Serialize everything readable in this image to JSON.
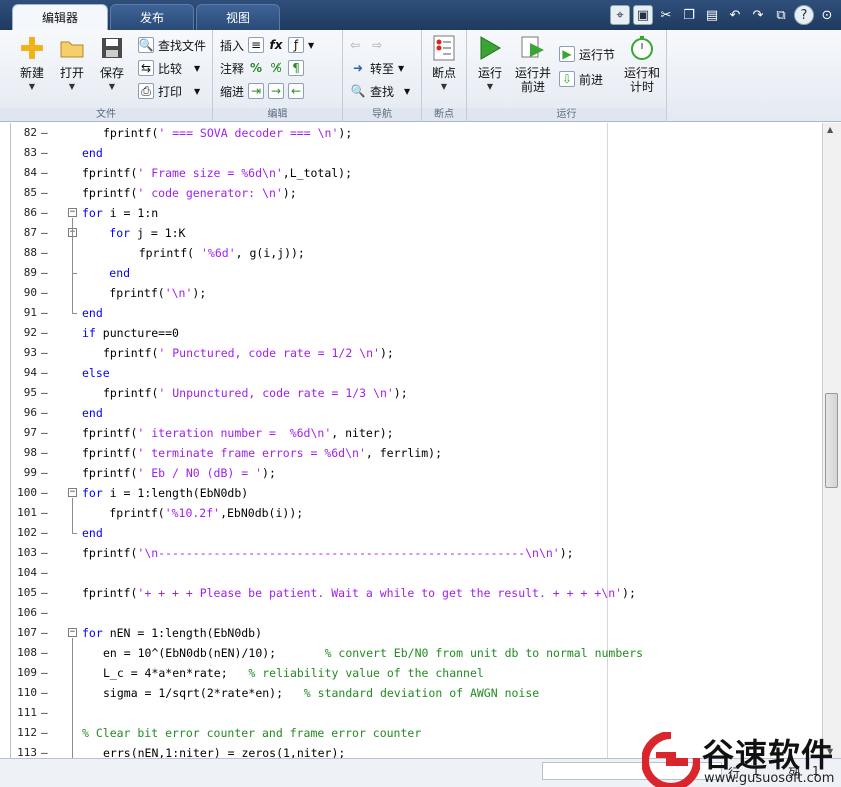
{
  "tabs": [
    {
      "label": "编辑器",
      "active": true
    },
    {
      "label": "发布",
      "active": false
    },
    {
      "label": "视图",
      "active": false
    }
  ],
  "ribbon": {
    "file": {
      "group_label": "文件",
      "new_label": "新建",
      "open_label": "打开",
      "save_label": "保存",
      "find_files_label": "查找文件",
      "compare_label": "比较",
      "print_label": "打印"
    },
    "edit": {
      "group_label": "编辑",
      "insert_label": "插入",
      "comment_label": "注释",
      "indent_label": "缩进"
    },
    "navigate": {
      "group_label": "导航",
      "goto_label": "转至",
      "find_label": "查找"
    },
    "breakpoints": {
      "group_label": "断点",
      "breakpoint_label": "断点"
    },
    "run": {
      "group_label": "运行",
      "run_label": "运行",
      "run_advance_label_1": "运行并",
      "run_advance_label_2": "前进",
      "run_section_label": "运行节",
      "advance_label": "前进",
      "run_time_label_1": "运行和",
      "run_time_label_2": "计时"
    }
  },
  "code_lines": [
    {
      "n": "82",
      "indent": 1,
      "tokens": [
        [
          "t",
          "fprintf("
        ],
        [
          "s",
          "' === SOVA decoder === \\n'"
        ],
        [
          "t",
          ");"
        ]
      ]
    },
    {
      "n": "83",
      "indent": 0,
      "tokens": [
        [
          "k",
          "end"
        ]
      ]
    },
    {
      "n": "84",
      "indent": 0,
      "tokens": [
        [
          "t",
          "fprintf("
        ],
        [
          "s",
          "' Frame size = %6d\\n'"
        ],
        [
          "t",
          ",L_total);"
        ]
      ]
    },
    {
      "n": "85",
      "indent": 0,
      "tokens": [
        [
          "t",
          "fprintf("
        ],
        [
          "s",
          "' code generator: \\n'"
        ],
        [
          "t",
          ");"
        ]
      ]
    },
    {
      "n": "86",
      "indent": 0,
      "tokens": [
        [
          "k",
          "for"
        ],
        [
          "t",
          " i = 1:n"
        ]
      ]
    },
    {
      "n": "87",
      "indent": 1.3,
      "tokens": [
        [
          "k",
          "for"
        ],
        [
          "t",
          " j = 1:K"
        ]
      ]
    },
    {
      "n": "88",
      "indent": 2.7,
      "tokens": [
        [
          "t",
          "fprintf( "
        ],
        [
          "s",
          "'%6d'"
        ],
        [
          "t",
          ", g(i,j));"
        ]
      ]
    },
    {
      "n": "89",
      "indent": 1.3,
      "tokens": [
        [
          "k",
          "end"
        ]
      ]
    },
    {
      "n": "90",
      "indent": 1.3,
      "tokens": [
        [
          "t",
          "fprintf("
        ],
        [
          "s",
          "'\\n'"
        ],
        [
          "t",
          ");"
        ]
      ]
    },
    {
      "n": "91",
      "indent": 0,
      "tokens": [
        [
          "k",
          "end"
        ]
      ]
    },
    {
      "n": "92",
      "indent": 0,
      "tokens": [
        [
          "k",
          "if"
        ],
        [
          "t",
          " puncture==0"
        ]
      ]
    },
    {
      "n": "93",
      "indent": 1,
      "tokens": [
        [
          "t",
          "fprintf("
        ],
        [
          "s",
          "' Punctured, code rate = 1/2 \\n'"
        ],
        [
          "t",
          ");"
        ]
      ]
    },
    {
      "n": "94",
      "indent": 0,
      "tokens": [
        [
          "k",
          "else"
        ]
      ]
    },
    {
      "n": "95",
      "indent": 1,
      "tokens": [
        [
          "t",
          "fprintf("
        ],
        [
          "s",
          "' Unpunctured, code rate = 1/3 \\n'"
        ],
        [
          "t",
          ");"
        ]
      ]
    },
    {
      "n": "96",
      "indent": 0,
      "tokens": [
        [
          "k",
          "end"
        ]
      ]
    },
    {
      "n": "97",
      "indent": 0,
      "tokens": [
        [
          "t",
          "fprintf("
        ],
        [
          "s",
          "' iteration number =  %6d\\n'"
        ],
        [
          "t",
          ", niter);"
        ]
      ]
    },
    {
      "n": "98",
      "indent": 0,
      "tokens": [
        [
          "t",
          "fprintf("
        ],
        [
          "s",
          "' terminate frame errors = %6d\\n'"
        ],
        [
          "t",
          ", ferrlim);"
        ]
      ]
    },
    {
      "n": "99",
      "indent": 0,
      "tokens": [
        [
          "t",
          "fprintf("
        ],
        [
          "s",
          "' Eb / N0 (dB) = '"
        ],
        [
          "t",
          ");"
        ]
      ]
    },
    {
      "n": "100",
      "indent": 0,
      "tokens": [
        [
          "k",
          "for"
        ],
        [
          "t",
          " i = 1:length(EbN0db)"
        ]
      ]
    },
    {
      "n": "101",
      "indent": 1.3,
      "tokens": [
        [
          "t",
          "fprintf("
        ],
        [
          "s",
          "'%10.2f'"
        ],
        [
          "t",
          ",EbN0db(i));"
        ]
      ]
    },
    {
      "n": "102",
      "indent": 0,
      "tokens": [
        [
          "k",
          "end"
        ]
      ]
    },
    {
      "n": "103",
      "indent": 0,
      "tokens": [
        [
          "t",
          "fprintf("
        ],
        [
          "s",
          "'\\n-----------------------------------------------------\\n\\n'"
        ],
        [
          "t",
          ");"
        ]
      ]
    },
    {
      "n": "104",
      "indent": 0,
      "tokens": []
    },
    {
      "n": "105",
      "indent": 0,
      "tokens": [
        [
          "t",
          "fprintf("
        ],
        [
          "s",
          "'+ + + + Please be patient. Wait a while to get the result. + + + +\\n'"
        ],
        [
          "t",
          ");"
        ]
      ]
    },
    {
      "n": "106",
      "indent": 0,
      "tokens": []
    },
    {
      "n": "107",
      "indent": 0,
      "tokens": [
        [
          "k",
          "for"
        ],
        [
          "t",
          " nEN = 1:length(EbN0db)"
        ]
      ]
    },
    {
      "n": "108",
      "indent": 1,
      "tokens": [
        [
          "t",
          "en = 10^(EbN0db(nEN)/10);       "
        ],
        [
          "c",
          "% convert Eb/N0 from unit db to normal numbers"
        ]
      ]
    },
    {
      "n": "109",
      "indent": 1,
      "tokens": [
        [
          "t",
          "L_c = 4*a*en*rate;   "
        ],
        [
          "c",
          "% reliability value of the channel"
        ]
      ]
    },
    {
      "n": "110",
      "indent": 1,
      "tokens": [
        [
          "t",
          "sigma = 1/sqrt(2*rate*en);   "
        ],
        [
          "c",
          "% standard deviation of AWGN noise"
        ]
      ]
    },
    {
      "n": "111",
      "indent": 0,
      "tokens": []
    },
    {
      "n": "112",
      "indent": 0,
      "tokens": [
        [
          "c",
          "% Clear bit error counter and frame error counter"
        ]
      ]
    },
    {
      "n": "113",
      "indent": 1,
      "tokens": [
        [
          "t",
          "errs(nEN,1:niter) = zeros(1,niter);"
        ]
      ]
    }
  ],
  "status": {
    "row_label": "行",
    "row_value": "1",
    "col_label": "列",
    "col_value": "1"
  },
  "watermark": {
    "brand_cn": "谷速软件",
    "url": "www.gusuosoft.com"
  },
  "colors": {
    "keyword": "#0000ff",
    "string": "#a020f0",
    "comment": "#228b22"
  }
}
